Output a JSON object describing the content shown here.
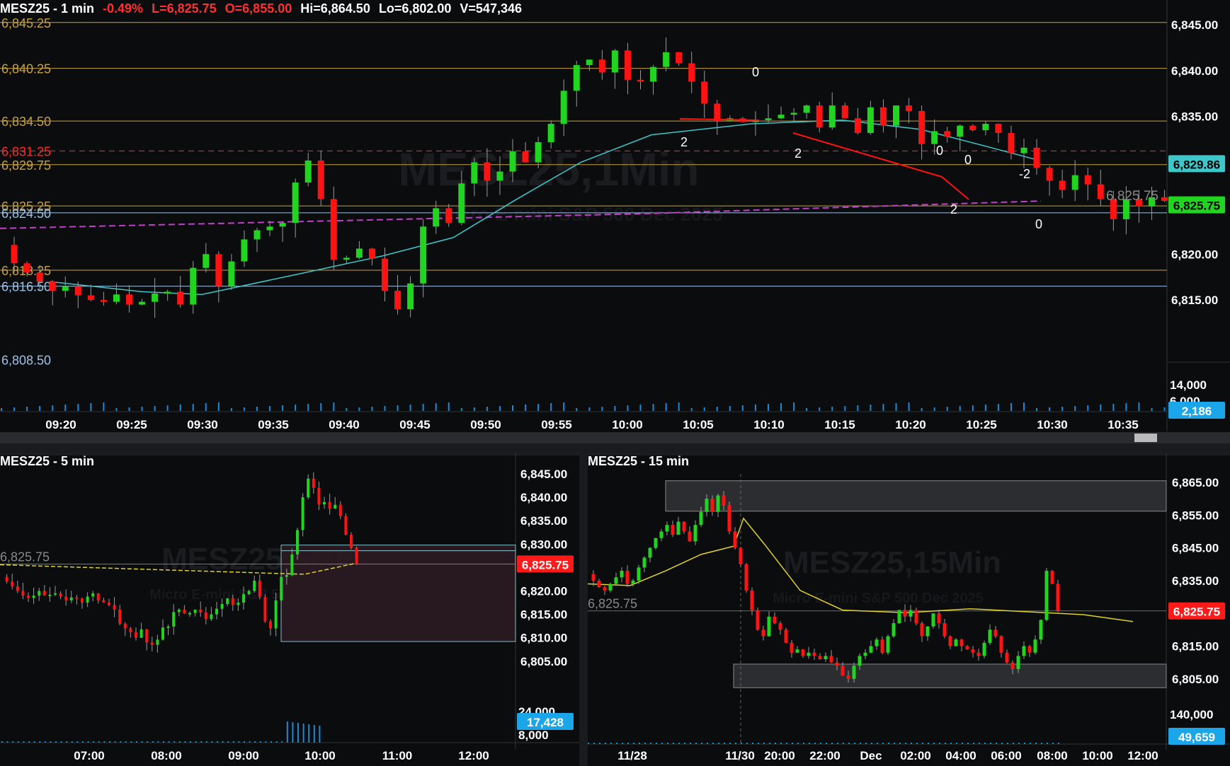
{
  "colors": {
    "background": "#0b0c0e",
    "bull": "#21d41f",
    "bear": "#ff1212",
    "level": "#c8a23c",
    "level_blue": "#9ec2e6",
    "ema": "#3fc6c9",
    "vwap": "#c040c8",
    "ma_yellow": "#e0d22a",
    "dashed_red": "#ff2a2a",
    "text_axis": "#ffffff",
    "last_price_bg": "#ff1a1a",
    "volume_badge_bg": "#1aa6e8"
  },
  "charts": {
    "one_min": {
      "header": {
        "symbol": "MESZ25 - 1 min",
        "change": "-0.49%",
        "last": "L=6,825.75",
        "open": "O=6,855.00",
        "high": "Hi=6,864.50",
        "low": "Lo=6,802.00",
        "volume": "V=547,346"
      },
      "watermark": {
        "title": "MESZ25,1Min",
        "subtitle": "Micro E-mini S&P 500 Dec 2025"
      },
      "price_ticks": [
        "6,845.00",
        "6,840.00",
        "6,835.00",
        "6,820.00",
        "6,815.00"
      ],
      "price_tick_values": [
        6845,
        6840,
        6835,
        6820,
        6815
      ],
      "time_ticks": [
        "09:20",
        "09:25",
        "09:30",
        "09:35",
        "09:40",
        "09:45",
        "09:50",
        "09:55",
        "10:00",
        "10:05",
        "10:10",
        "10:15",
        "10:20",
        "10:25",
        "10:30",
        "10:35"
      ],
      "levels": [
        {
          "label": "6,845.25",
          "value": 6845.25,
          "color": "#c8a23c"
        },
        {
          "label": "6,840.25",
          "value": 6840.25,
          "color": "#c8a23c"
        },
        {
          "label": "6,834.50",
          "value": 6834.5,
          "color": "#c8a23c"
        },
        {
          "label": "6,831.25",
          "value": 6831.25,
          "color": "#ff2a2a",
          "dashed": true
        },
        {
          "label": "6,829.75",
          "value": 6829.75,
          "color": "#c8a23c"
        },
        {
          "label": "6,825.25",
          "value": 6825.25,
          "color": "#c8a23c"
        },
        {
          "label": "6,824.50",
          "value": 6824.5,
          "color": "#9ec2e6"
        },
        {
          "label": "6,818.25",
          "value": 6818.25,
          "color": "#c8a23c"
        },
        {
          "label": "6,816.50",
          "value": 6816.5,
          "color": "#9ec2e6"
        },
        {
          "label": "6,808.50",
          "value": 6808.5,
          "color": "#9ec2e6",
          "line": false
        }
      ],
      "price_label": "6,825.75",
      "last_price_badge": "6,825.75",
      "ema_badge": "6,829.86",
      "volume_ticks": [
        "14,000",
        "6,000"
      ],
      "volume_badge": "2,186",
      "annotations": [
        "0",
        "2",
        "2",
        "0",
        "0",
        "-2",
        "2",
        "0"
      ]
    },
    "five_min": {
      "header": {
        "symbol": "MESZ25 - 5 min"
      },
      "watermark": {
        "title": "MESZ25,5Min",
        "subtitle": "Micro E-mini S&P 500 Dec 2025"
      },
      "price_ticks": [
        "6,845.00",
        "6,840.00",
        "6,835.00",
        "6,830.00",
        "6,820.00",
        "6,815.00",
        "6,810.00",
        "6,805.00"
      ],
      "price_tick_values": [
        6845,
        6840,
        6835,
        6830,
        6820,
        6815,
        6810,
        6805
      ],
      "time_ticks": [
        "07:00",
        "08:00",
        "09:00",
        "10:00",
        "11:00",
        "12:00"
      ],
      "price_label": "6,825.75",
      "last_price_badge": "6,825.75",
      "volume_ticks": [
        "24,000",
        "8,000"
      ],
      "volume_badge": "17,428"
    },
    "fifteen_min": {
      "header": {
        "symbol": "MESZ25 - 15 min"
      },
      "watermark": {
        "title": "MESZ25,15Min",
        "subtitle": "Micro E-mini S&P 500 Dec 2025"
      },
      "price_ticks": [
        "6,865.00",
        "6,855.00",
        "6,845.00",
        "6,835.00",
        "6,815.00",
        "6,805.00"
      ],
      "price_tick_values": [
        6865,
        6855,
        6845,
        6835,
        6815,
        6805
      ],
      "time_ticks": [
        "11/28",
        "11/30",
        "20:00",
        "22:00",
        "Dec",
        "02:00",
        "04:00",
        "06:00",
        "08:00",
        "10:00",
        "12:00"
      ],
      "price_label": "6,825.75",
      "last_price_badge": "6,825.75",
      "volume_ticks": [
        "140,000"
      ],
      "volume_badge": "49,659"
    }
  }
}
